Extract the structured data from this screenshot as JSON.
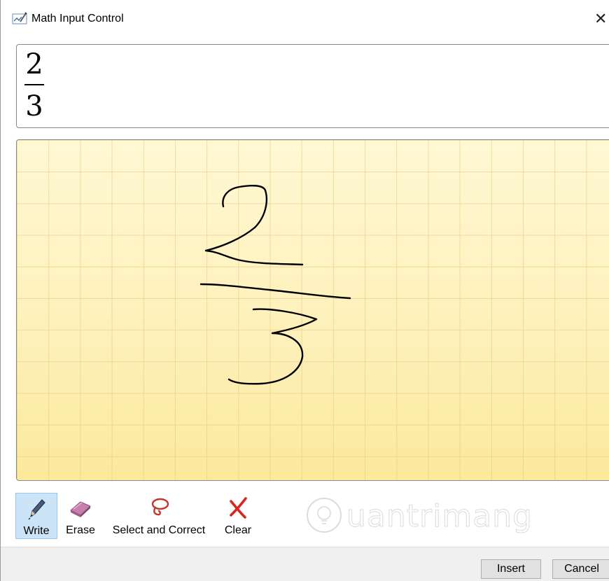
{
  "window": {
    "title": "Math Input Control",
    "close_glyph": "✕",
    "icon": "math-input-app-icon"
  },
  "preview": {
    "numerator": "2",
    "denominator": "3"
  },
  "canvas": {
    "ink_color": "#000000",
    "background_color": "#fdf0b8",
    "grid_color": "#e8c478"
  },
  "toolbar": {
    "tools": [
      {
        "label": "Write",
        "icon": "pen-icon",
        "active": true
      },
      {
        "label": "Erase",
        "icon": "eraser-icon",
        "active": false
      },
      {
        "label": "Select and Correct",
        "icon": "lasso-icon",
        "active": false
      },
      {
        "label": "Clear",
        "icon": "red-x-icon",
        "active": false
      }
    ],
    "watermark": "uantrimang"
  },
  "buttons": {
    "insert": "Insert",
    "cancel": "Cancel"
  },
  "colors": {
    "active_tool_bg": "#cce4f7",
    "active_tool_border": "#99c9ef",
    "clear_icon": "#d9261c",
    "lasso_icon": "#c0392b"
  }
}
